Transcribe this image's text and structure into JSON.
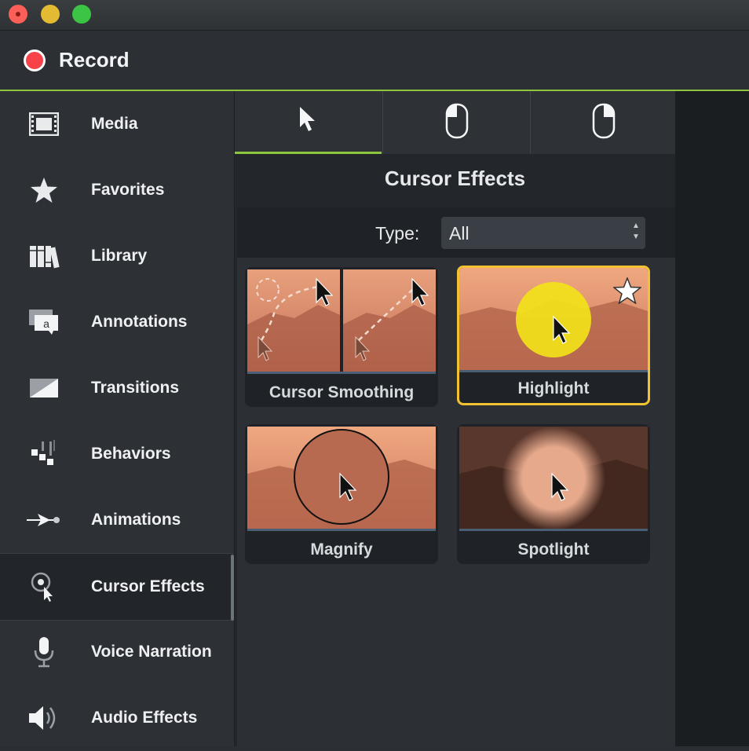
{
  "window": {
    "controls": [
      "close",
      "minimize",
      "maximize"
    ]
  },
  "record": {
    "label": "Record"
  },
  "sidebar": {
    "items": [
      {
        "label": "Media",
        "icon": "film-icon"
      },
      {
        "label": "Favorites",
        "icon": "star-icon"
      },
      {
        "label": "Library",
        "icon": "books-icon"
      },
      {
        "label": "Annotations",
        "icon": "speech-bubble-icon"
      },
      {
        "label": "Transitions",
        "icon": "transition-icon"
      },
      {
        "label": "Behaviors",
        "icon": "behaviors-icon"
      },
      {
        "label": "Animations",
        "icon": "animation-arrow-icon"
      },
      {
        "label": "Cursor Effects",
        "icon": "cursor-effects-icon",
        "active": true
      },
      {
        "label": "Voice Narration",
        "icon": "microphone-icon"
      },
      {
        "label": "Audio Effects",
        "icon": "speaker-icon"
      }
    ]
  },
  "tabs": [
    {
      "icon": "cursor-arrow-icon",
      "active": true
    },
    {
      "icon": "mouse-left-click-icon"
    },
    {
      "icon": "mouse-right-click-icon"
    }
  ],
  "panel": {
    "title": "Cursor Effects",
    "type_label": "Type:",
    "type_value": "All"
  },
  "effects": [
    {
      "label": "Cursor Smoothing"
    },
    {
      "label": "Highlight",
      "selected": true,
      "favorite": true
    },
    {
      "label": "Magnify"
    },
    {
      "label": "Spotlight"
    }
  ],
  "colors": {
    "accent": "#8cc63f",
    "selected_border": "#f2c232",
    "record": "#f8424a"
  }
}
